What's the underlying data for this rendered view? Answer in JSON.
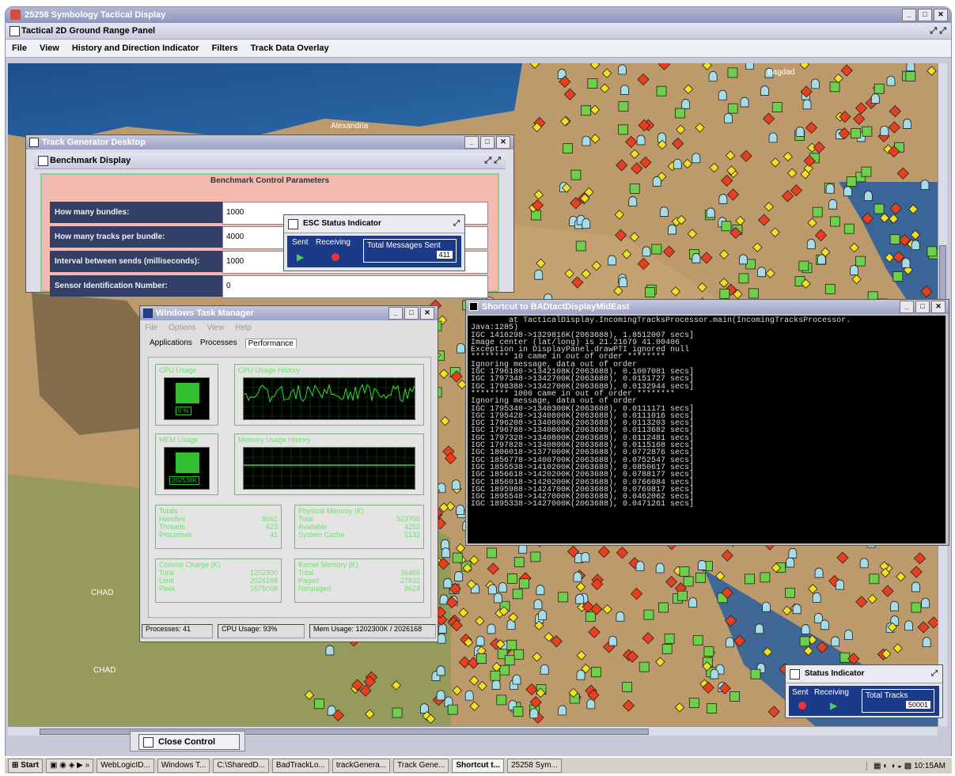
{
  "app_title": "25258 Symbology Tactical Display",
  "panel_title": "Tactical 2D Ground Range Panel",
  "menu": [
    "File",
    "View",
    "History and Direction Indicator",
    "Filters",
    "Track Data Overlay"
  ],
  "map_labels": {
    "alexandria": "Alexandria",
    "top_city": "Bagdad",
    "chad1": "CHAD",
    "chad2": "CHAD"
  },
  "track_generator": {
    "title": "Track Generator Desktop",
    "benchmark_title": "Benchmark Display",
    "section_title": "Benchmark Control Parameters",
    "fields": [
      {
        "label": "How many bundles:",
        "value": "1000"
      },
      {
        "label": "How many tracks per bundle:",
        "value": "4000"
      },
      {
        "label": "Interval between sends (milliseconds):",
        "value": "1000"
      },
      {
        "label": "Sensor Identification Number:",
        "value": "0"
      }
    ]
  },
  "esc_status": {
    "title": "ESC Status Indicator",
    "sent": "Sent",
    "receiving": "Receiving",
    "total_label": "Total Messages Sent",
    "total_value": "411"
  },
  "task_manager": {
    "title": "Windows Task Manager",
    "menu": [
      "File",
      "Options",
      "View",
      "Help"
    ],
    "tabs": [
      "Applications",
      "Processes",
      "Performance"
    ],
    "cpu_usage_label": "CPU Usage",
    "cpu_value": "0 %",
    "cpu_history_label": "CPU Usage History",
    "mem_usage_label": "MEM Usage",
    "mem_value": "202536K",
    "mem_history_label": "Memory Usage History",
    "totals": {
      "title": "Totals",
      "rows": [
        {
          "label": "Handles",
          "value": "8662"
        },
        {
          "label": "Threads",
          "value": "623"
        },
        {
          "label": "Processes",
          "value": "41"
        }
      ]
    },
    "physical": {
      "title": "Physical Memory (K)",
      "rows": [
        {
          "label": "Total",
          "value": "523756"
        },
        {
          "label": "Available",
          "value": "4252"
        },
        {
          "label": "System Cache",
          "value": "5132"
        }
      ]
    },
    "commit": {
      "title": "Commit Charge (K)",
      "rows": [
        {
          "label": "Total",
          "value": "1202300"
        },
        {
          "label": "Limit",
          "value": "2026168"
        },
        {
          "label": "Peak",
          "value": "1575008"
        }
      ]
    },
    "kernel": {
      "title": "Kernel Memory (K)",
      "rows": [
        {
          "label": "Total",
          "value": "36456"
        },
        {
          "label": "Paged",
          "value": "27832"
        },
        {
          "label": "Nonpaged",
          "value": "8624"
        }
      ]
    },
    "status": {
      "processes": "Processes: 41",
      "cpu": "CPU Usage: 93%",
      "mem": "Mem Usage: 1202300K / 2026168"
    }
  },
  "shortcut": {
    "title": "Shortcut to BADtactDisplayMidEast",
    "lines": [
      "        at TacticalDisplay.IncomingTracksProcessor.main(IncomingTracksProcessor.",
      "Java:1285)",
      "IGC 1416298->1329816K(2063688), 1.8512007 secs]",
      "Image center (lat/long) is 21.21679 41.00406",
      "Exception in DisplayPanel.drawPTI ignored null",
      "******** 10 came in out of order ********",
      "Ignoring message, data out of order",
      "IGC 1796180->1342108K(2063688), 0.1007081 secs]",
      "IGC 1797348->1342700K(2063688), 0.0151727 secs]",
      "IGC 1798388->1342700K(2063688), 0.0132944 secs]",
      "******** 1000 came in out of order ********",
      "Ignoring message, data out of order",
      "IGC 1795340->1340300K(2063688), 0.0111171 secs]",
      "IGC 1795428->1340800K(2063688), 0.0111016 secs]",
      "IGC 1796208->1340800K(2063688), 0.0113203 secs]",
      "IGC 1796788->1340800K(2063688), 0.0113682 secs]",
      "IGC 1797328->1340800K(2063688), 0.0112481 secs]",
      "IGC 1797828->1340800K(2063688), 0.0115168 secs]",
      "IGC 1806018->1377000K(2063688), 0.0772876 secs]",
      "IGC 1856778->1400700K(2063688), 0.0752547 secs]",
      "IGC 1855538->1410200K(2063688), 0.0850617 secs]",
      "IGC 1856618->1420200K(2063688), 0.0788177 secs]",
      "IGC 1856018->1420200K(2063688), 0.0766084 secs]",
      "IGC 1895988->1424700K(2063688), 0.0769817 secs]",
      "IGC 1895548->1427000K(2063688), 0.0462062 secs]",
      "IGC 1895338->1427000K(2063688), 0.0471261 secs]"
    ]
  },
  "status_indicator": {
    "title": "Status Indicator",
    "sent": "Sent",
    "receiving": "Receiving",
    "total_label": "Total Tracks",
    "total_value": "50001"
  },
  "close_control": "Close Control",
  "taskbar": {
    "start": "Start",
    "items": [
      "WebLogicID...",
      "Windows T...",
      "C:\\SharedD...",
      "BadTrackLo...",
      "trackGenera...",
      "Track Gene...",
      "Shortcut t...",
      "25258 Sym..."
    ],
    "clock": "10:15AM"
  },
  "colors": {
    "hostile": "#e8401f",
    "unknown": "#f4e020",
    "friendly": "#6dcf4a",
    "neutral": "#a6dbe8",
    "console_bg": "#000000"
  }
}
